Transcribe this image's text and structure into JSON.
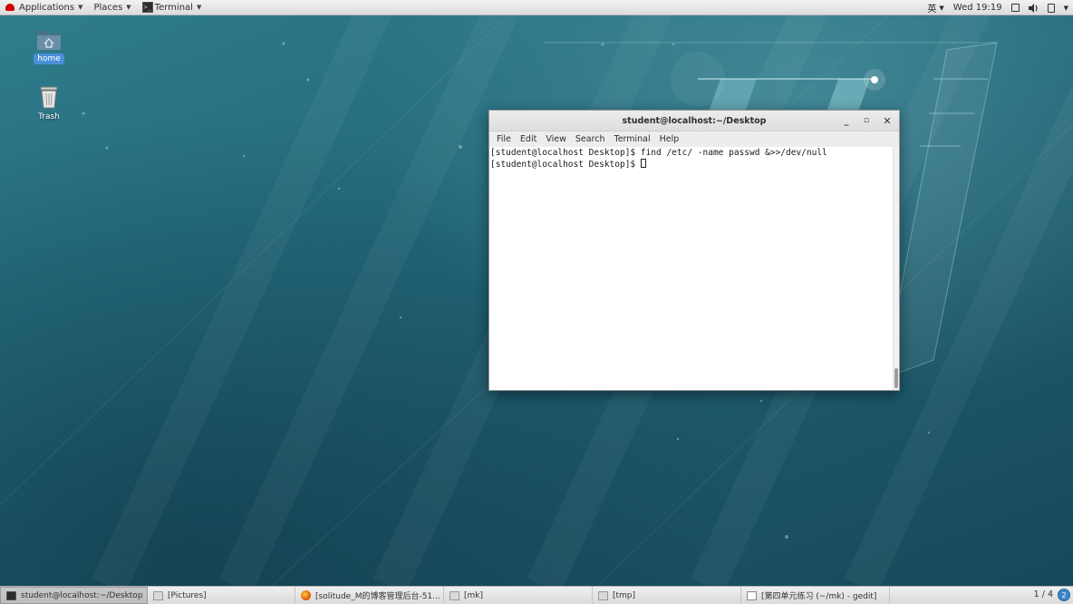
{
  "top_bar": {
    "applications_label": "Applications",
    "places_label": "Places",
    "terminal_label": "Terminal",
    "input_method": "英",
    "clock": "Wed 19:19"
  },
  "desktop": {
    "icons": [
      {
        "label": "home",
        "icon": "home-folder-icon"
      },
      {
        "label": "Trash",
        "icon": "trash-icon"
      }
    ]
  },
  "terminal_window": {
    "title": "student@localhost:~/Desktop",
    "menu": [
      "File",
      "Edit",
      "View",
      "Search",
      "Terminal",
      "Help"
    ],
    "lines": [
      "[student@localhost Desktop]$ find /etc/ -name passwd &>>/dev/null",
      "[student@localhost Desktop]$ "
    ]
  },
  "taskbar": {
    "tasks": [
      {
        "label": "student@localhost:~/Desktop",
        "icon": "terminal-icon",
        "active": true
      },
      {
        "label": "[Pictures]",
        "icon": "folder-icon",
        "active": false
      },
      {
        "label": "[solitude_M的博客管理后台-51...",
        "icon": "firefox-icon",
        "active": false
      },
      {
        "label": "[mk]",
        "icon": "folder-icon",
        "active": false
      },
      {
        "label": "[tmp]",
        "icon": "folder-icon",
        "active": false
      },
      {
        "label": "[第四单元练习 (~/mk) - gedit]",
        "icon": "gedit-icon",
        "active": false
      }
    ],
    "workspace": "1 / 4",
    "notification_count": "2"
  },
  "colors": {
    "wallpaper": "#226779",
    "panel": "#e6e6e6",
    "home_label_highlight": "#4a90d9"
  }
}
